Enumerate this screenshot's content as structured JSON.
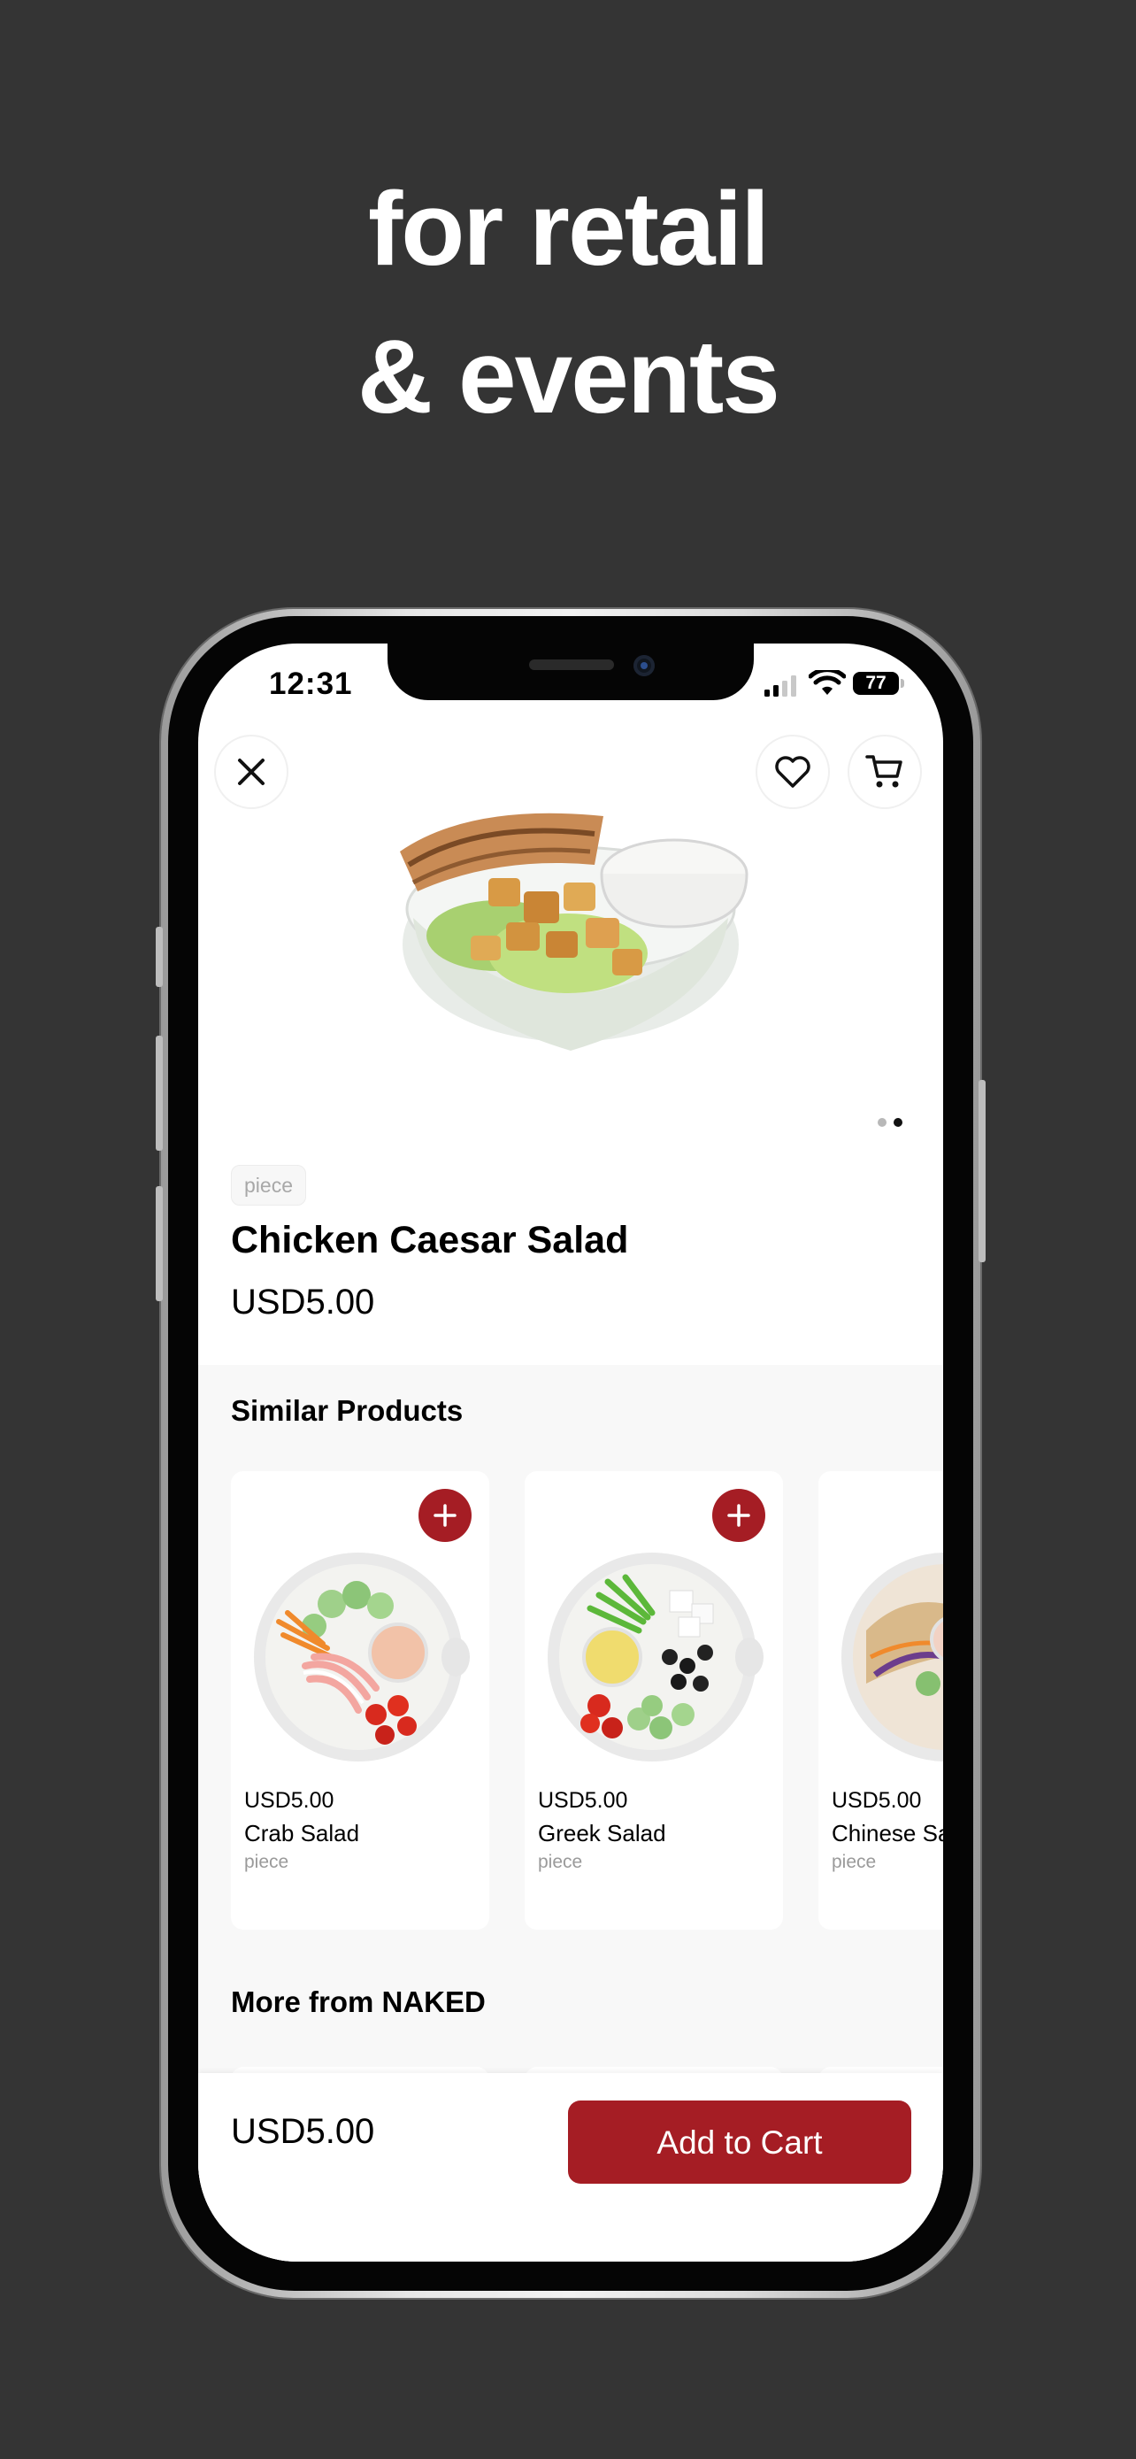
{
  "promo": {
    "line1": "for retail",
    "line2": "& events"
  },
  "status_bar": {
    "time": "12:31",
    "battery": "77"
  },
  "product": {
    "unit": "piece",
    "name": "Chicken Caesar Salad",
    "price": "USD5.00",
    "image_icon": "caesar-salad-bowl",
    "gallery_pages": 2,
    "gallery_current": 2
  },
  "similar": {
    "title": "Similar Products",
    "items": [
      {
        "price": "USD5.00",
        "name": "Crab Salad",
        "unit": "piece",
        "image_icon": "crab-salad-bowl"
      },
      {
        "price": "USD5.00",
        "name": "Greek Salad",
        "unit": "piece",
        "image_icon": "greek-salad-bowl"
      },
      {
        "price": "USD5.00",
        "name": "Chinese Salad",
        "unit": "piece",
        "image_icon": "chinese-salad-bowl"
      }
    ]
  },
  "more": {
    "title": "More from NAKED"
  },
  "cart_bar": {
    "price": "USD5.00",
    "button_label": "Add to Cart"
  },
  "colors": {
    "background": "#343434",
    "accent": "#a51d24",
    "section_bg": "#f8f8f8"
  },
  "icons": {
    "close": "close-icon",
    "favorite": "heart-icon",
    "cart": "cart-icon",
    "add": "plus-icon"
  }
}
